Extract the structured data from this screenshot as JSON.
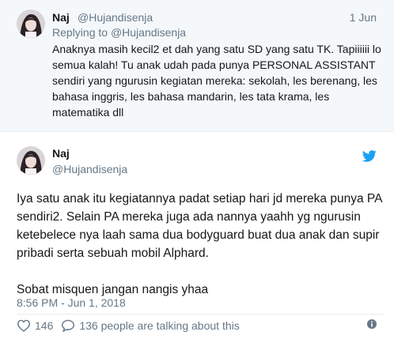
{
  "reply": {
    "name": "Naj",
    "handle": "@Hujandisenja",
    "date": "1 Jun",
    "replying_to_prefix": "Replying to ",
    "replying_to_handle": "@Hujandisenja",
    "text": "Anaknya masih kecil2 et dah yang satu SD yang satu TK. Tapiiiiii lo semua kalah! Tu anak udah pada punya PERSONAL ASSISTANT sendiri yang ngurusin kegiatan mereka: sekolah, les berenang, les bahasa inggris, les bahasa mandarin, les tata krama, les matematika dll"
  },
  "tweet": {
    "name": "Naj",
    "handle": "@Hujandisenja",
    "paragraph_1": "Iya satu anak itu kegiatannya padat setiap hari jd mereka punya PA sendiri2. Selain PA mereka juga ada nannya yaahh yg ngurusin ketebelece nya laah sama dua bodyguard buat dua anak dan supir pribadi serta sebuah mobil Alphard.",
    "paragraph_2": "Sobat misquen jangan nangis yhaa",
    "timestamp": "8:56 PM - Jun 1, 2018",
    "likes": "146",
    "talking": "136 people are talking about this"
  },
  "colors": {
    "text": "#14171a",
    "secondary": "#657786",
    "twitter_blue": "#1da1f2",
    "reply_bg": "#f5f8fa"
  },
  "icons": [
    "avatar",
    "twitter-bird-icon",
    "heart-icon",
    "comment-icon",
    "info-icon"
  ]
}
